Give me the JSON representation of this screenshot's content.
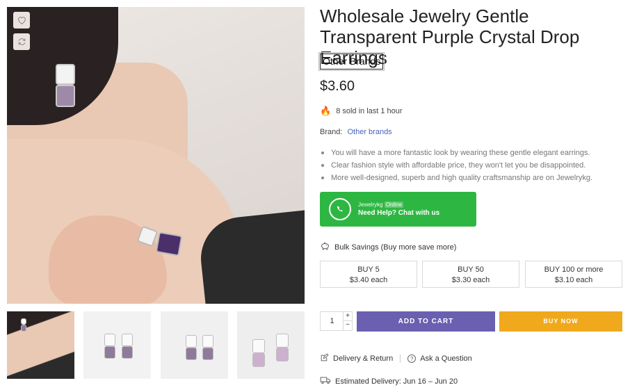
{
  "product": {
    "title": "Wholesale Jewelry Gentle Transparent Purple Crystal Drop Earrings",
    "brand_badge": "Other Brands",
    "price": "$3.60",
    "sold_text": "8 sold in last 1 hour",
    "brand_label": "Brand:",
    "brand_value": "Other brands",
    "features": [
      "You will have a more fantastic look by wearing these gentle elegant earrings.",
      "Clear fashion style with affordable price, they won't let you be disappointed.",
      "More well-designed, superb and high quality craftsmanship are on Jewelrykg."
    ]
  },
  "whatsapp": {
    "name": "Jewelrykg",
    "status": "Online",
    "help": "Need Help? Chat with us",
    "color": "#2db742"
  },
  "bulk": {
    "heading": "Bulk Savings (Buy more save more)",
    "tiers": [
      {
        "qty": "BUY 5",
        "price": "$3.40 each"
      },
      {
        "qty": "BUY 50",
        "price": "$3.30 each"
      },
      {
        "qty": "BUY 100 or more",
        "price": "$3.10 each"
      }
    ]
  },
  "cart": {
    "quantity": "1",
    "plus": "+",
    "minus": "−",
    "add_to_cart": "ADD TO CART",
    "buy_now": "BUY NOW",
    "add_color": "#6a5fb0",
    "buy_color": "#f0a81c"
  },
  "links": {
    "delivery_return": "Delivery & Return",
    "ask_question": "Ask a Question"
  },
  "delivery": {
    "text": "Estimated Delivery: Jun 16 – Jun 20"
  },
  "icons": {
    "wishlist": "heart-icon",
    "compare": "refresh-icon",
    "sold": "fire-icon",
    "whatsapp": "whatsapp-icon",
    "bulk": "piggy-bank-icon",
    "delivery_return": "edit-icon",
    "ask": "question-icon",
    "truck": "truck-icon"
  }
}
